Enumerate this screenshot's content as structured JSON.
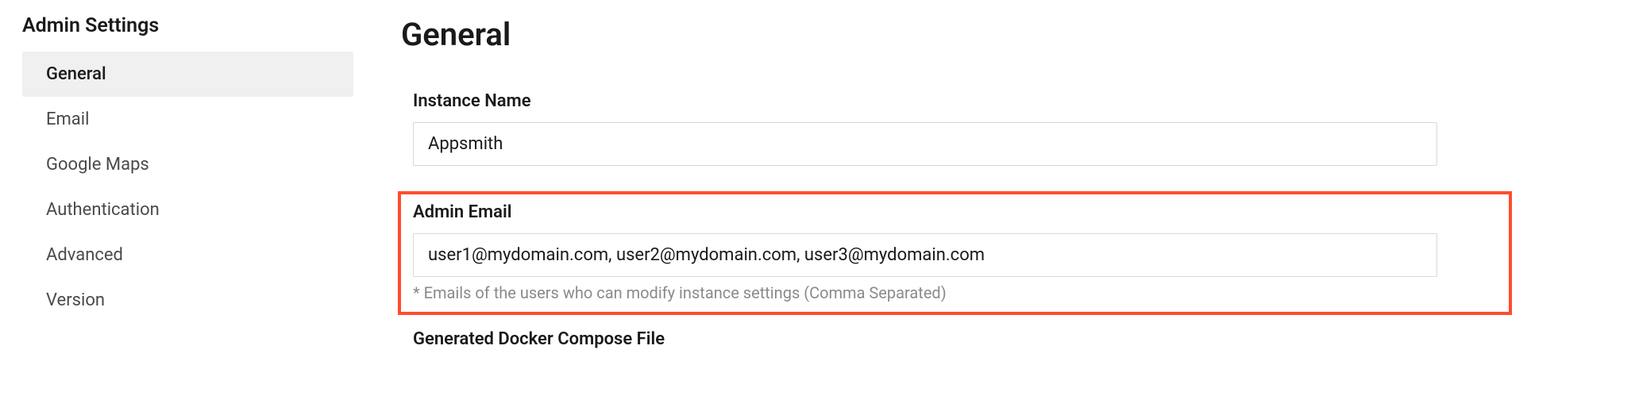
{
  "sidebar": {
    "title": "Admin Settings",
    "items": [
      {
        "label": "General",
        "active": true
      },
      {
        "label": "Email",
        "active": false
      },
      {
        "label": "Google Maps",
        "active": false
      },
      {
        "label": "Authentication",
        "active": false
      },
      {
        "label": "Advanced",
        "active": false
      },
      {
        "label": "Version",
        "active": false
      }
    ]
  },
  "main": {
    "title": "General",
    "instance_name": {
      "label": "Instance Name",
      "value": "Appsmith"
    },
    "admin_email": {
      "label": "Admin Email",
      "value": "user1@mydomain.com, user2@mydomain.com, user3@mydomain.com",
      "help": "* Emails of the users who can modify instance settings (Comma Separated)"
    },
    "docker_heading": "Generated Docker Compose File"
  }
}
